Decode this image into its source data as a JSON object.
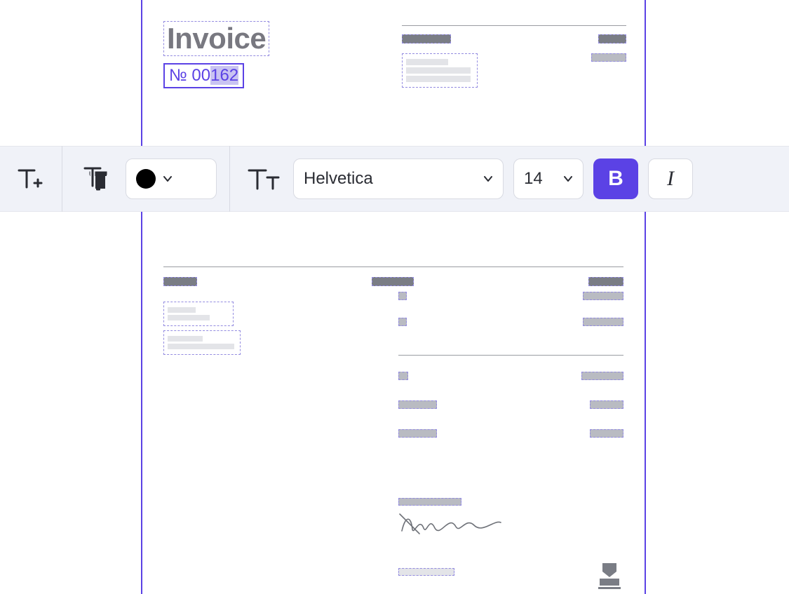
{
  "document": {
    "title": "Invoice",
    "number_prefix": "№ 00",
    "number_highlight": "162"
  },
  "toolbar": {
    "font_family": "Helvetica",
    "font_size": "14",
    "bold_label": "B",
    "italic_label": "I",
    "color_swatch": "#000000"
  }
}
